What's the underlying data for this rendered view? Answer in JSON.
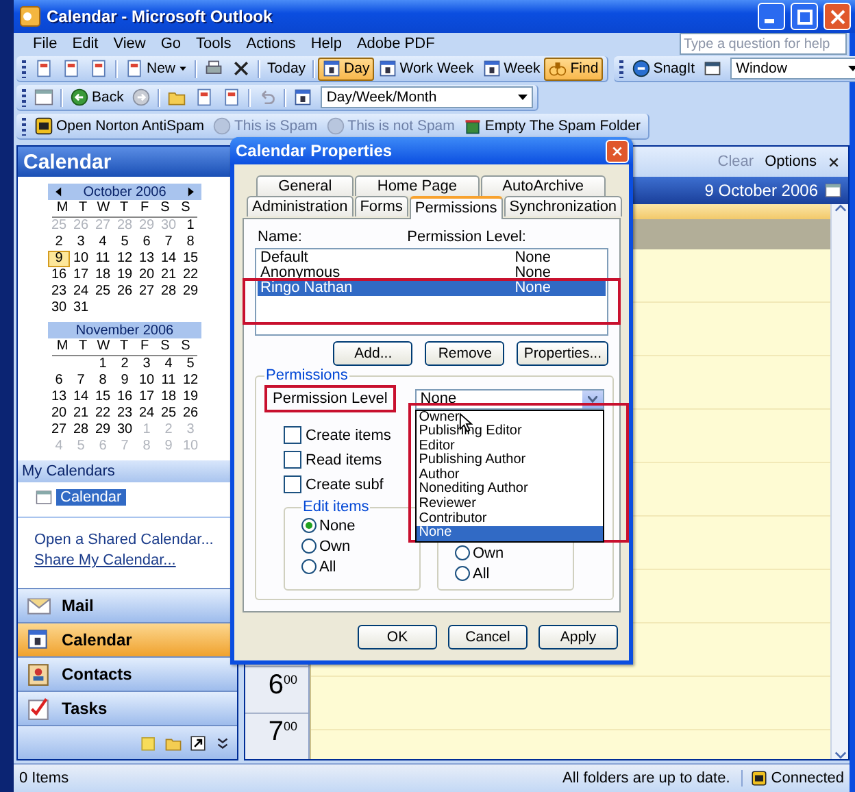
{
  "window": {
    "title": "Calendar - Microsoft Outlook"
  },
  "menu_bar": {
    "items": [
      "File",
      "Edit",
      "View",
      "Go",
      "Tools",
      "Actions",
      "Help",
      "Adobe PDF"
    ],
    "help_box": {
      "placeholder": "Type a question for help"
    }
  },
  "toolbar_rows": [
    [
      {
        "items": [
          {
            "kind": "icon"
          },
          {
            "kind": "icon"
          },
          {
            "kind": "icon"
          },
          {
            "kind": "separator"
          },
          {
            "kind": "menu_button",
            "label": "New",
            "selected": false,
            "disabled": false
          },
          {
            "kind": "separator"
          },
          {
            "kind": "icon"
          },
          {
            "kind": "icon"
          },
          {
            "kind": "separator"
          },
          {
            "kind": "button",
            "label": "Today",
            "selected": false,
            "disabled": false
          },
          {
            "kind": "separator"
          },
          {
            "kind": "icon_button",
            "label": "Day",
            "selected": true,
            "disabled": false
          },
          {
            "kind": "icon_button",
            "label": "Work Week",
            "selected": false,
            "disabled": false
          },
          {
            "kind": "icon_button",
            "label": "Week",
            "selected": false,
            "disabled": false
          },
          {
            "kind": "icon_button",
            "label": "Find",
            "selected": true,
            "disabled": false
          }
        ]
      },
      {
        "items": [
          {
            "kind": "icon_button",
            "label": "SnagIt",
            "selected": false,
            "disabled": false
          },
          {
            "kind": "icon"
          },
          {
            "kind": "dropdown",
            "value": "Window"
          }
        ]
      }
    ],
    [
      {
        "items": [
          {
            "kind": "icon"
          },
          {
            "kind": "separator"
          },
          {
            "kind": "icon_button",
            "label": "Back",
            "selected": false,
            "disabled": false
          },
          {
            "kind": "icon"
          },
          {
            "kind": "separator"
          },
          {
            "kind": "icon"
          },
          {
            "kind": "icon"
          },
          {
            "kind": "icon"
          },
          {
            "kind": "separator"
          },
          {
            "kind": "icon"
          },
          {
            "kind": "separator"
          },
          {
            "kind": "icon"
          },
          {
            "kind": "dropdown",
            "value": "Day/Week/Month"
          }
        ]
      }
    ],
    [
      {
        "items": [
          {
            "kind": "icon_button",
            "label": "Open Norton AntiSpam",
            "selected": false,
            "disabled": false
          },
          {
            "kind": "icon_button",
            "label": "This is Spam",
            "selected": false,
            "disabled": true
          },
          {
            "kind": "icon_button",
            "label": "This is not Spam",
            "selected": false,
            "disabled": true
          },
          {
            "kind": "icon_button",
            "label": "Empty The Spam Folder",
            "selected": false,
            "disabled": false
          }
        ]
      }
    ]
  ],
  "navigation_pane": {
    "title": "Calendar",
    "months": [
      {
        "title": "October 2006",
        "arrows": true,
        "weekdays": [
          "M",
          "T",
          "W",
          "T",
          "F",
          "S",
          "S"
        ],
        "weeks": [
          [
            {
              "kind": "day",
              "day": "25",
              "muted": true,
              "selected": false
            },
            {
              "kind": "day",
              "day": "26",
              "muted": true,
              "selected": false
            },
            {
              "kind": "day",
              "day": "27",
              "muted": true,
              "selected": false
            },
            {
              "kind": "day",
              "day": "28",
              "muted": true,
              "selected": false
            },
            {
              "kind": "day",
              "day": "29",
              "muted": true,
              "selected": false
            },
            {
              "kind": "day",
              "day": "30",
              "muted": true,
              "selected": false
            },
            {
              "kind": "day",
              "day": "1",
              "muted": false,
              "selected": false
            }
          ],
          [
            {
              "kind": "day",
              "day": "2",
              "muted": false,
              "selected": false
            },
            {
              "kind": "day",
              "day": "3",
              "muted": false,
              "selected": false
            },
            {
              "kind": "day",
              "day": "4",
              "muted": false,
              "selected": false
            },
            {
              "kind": "day",
              "day": "5",
              "muted": false,
              "selected": false
            },
            {
              "kind": "day",
              "day": "6",
              "muted": false,
              "selected": false
            },
            {
              "kind": "day",
              "day": "7",
              "muted": false,
              "selected": false
            },
            {
              "kind": "day",
              "day": "8",
              "muted": false,
              "selected": false
            }
          ],
          [
            {
              "kind": "day",
              "day": "9",
              "muted": false,
              "selected": true
            },
            {
              "kind": "day",
              "day": "10",
              "muted": false,
              "selected": false
            },
            {
              "kind": "day",
              "day": "11",
              "muted": false,
              "selected": false
            },
            {
              "kind": "day",
              "day": "12",
              "muted": false,
              "selected": false
            },
            {
              "kind": "day",
              "day": "13",
              "muted": false,
              "selected": false
            },
            {
              "kind": "day",
              "day": "14",
              "muted": false,
              "selected": false
            },
            {
              "kind": "day",
              "day": "15",
              "muted": false,
              "selected": false
            }
          ],
          [
            {
              "kind": "day",
              "day": "16",
              "muted": false,
              "selected": false
            },
            {
              "kind": "day",
              "day": "17",
              "muted": false,
              "selected": false
            },
            {
              "kind": "day",
              "day": "18",
              "muted": false,
              "selected": false
            },
            {
              "kind": "day",
              "day": "19",
              "muted": false,
              "selected": false
            },
            {
              "kind": "day",
              "day": "20",
              "muted": false,
              "selected": false
            },
            {
              "kind": "day",
              "day": "21",
              "muted": false,
              "selected": false
            },
            {
              "kind": "day",
              "day": "22",
              "muted": false,
              "selected": false
            }
          ],
          [
            {
              "kind": "day",
              "day": "23",
              "muted": false,
              "selected": false
            },
            {
              "kind": "day",
              "day": "24",
              "muted": false,
              "selected": false
            },
            {
              "kind": "day",
              "day": "25",
              "muted": false,
              "selected": false
            },
            {
              "kind": "day",
              "day": "26",
              "muted": false,
              "selected": false
            },
            {
              "kind": "day",
              "day": "27",
              "muted": false,
              "selected": false
            },
            {
              "kind": "day",
              "day": "28",
              "muted": false,
              "selected": false
            },
            {
              "kind": "day",
              "day": "29",
              "muted": false,
              "selected": false
            }
          ],
          [
            {
              "kind": "day",
              "day": "30",
              "muted": false,
              "selected": false
            },
            {
              "kind": "day",
              "day": "31",
              "muted": false,
              "selected": false
            },
            {
              "kind": "blank"
            },
            {
              "kind": "blank"
            },
            {
              "kind": "blank"
            },
            {
              "kind": "blank"
            },
            {
              "kind": "blank"
            }
          ]
        ]
      },
      {
        "title": "November 2006",
        "arrows": false,
        "weekdays": [
          "M",
          "T",
          "W",
          "T",
          "F",
          "S",
          "S"
        ],
        "weeks": [
          [
            {
              "kind": "blank"
            },
            {
              "kind": "blank"
            },
            {
              "kind": "day",
              "day": "1",
              "muted": false,
              "selected": false
            },
            {
              "kind": "day",
              "day": "2",
              "muted": false,
              "selected": false
            },
            {
              "kind": "day",
              "day": "3",
              "muted": false,
              "selected": false
            },
            {
              "kind": "day",
              "day": "4",
              "muted": false,
              "selected": false
            },
            {
              "kind": "day",
              "day": "5",
              "muted": false,
              "selected": false
            }
          ],
          [
            {
              "kind": "day",
              "day": "6",
              "muted": false,
              "selected": false
            },
            {
              "kind": "day",
              "day": "7",
              "muted": false,
              "selected": false
            },
            {
              "kind": "day",
              "day": "8",
              "muted": false,
              "selected": false
            },
            {
              "kind": "day",
              "day": "9",
              "muted": false,
              "selected": false
            },
            {
              "kind": "day",
              "day": "10",
              "muted": false,
              "selected": false
            },
            {
              "kind": "day",
              "day": "11",
              "muted": false,
              "selected": false
            },
            {
              "kind": "day",
              "day": "12",
              "muted": false,
              "selected": false
            }
          ],
          [
            {
              "kind": "day",
              "day": "13",
              "muted": false,
              "selected": false
            },
            {
              "kind": "day",
              "day": "14",
              "muted": false,
              "selected": false
            },
            {
              "kind": "day",
              "day": "15",
              "muted": false,
              "selected": false
            },
            {
              "kind": "day",
              "day": "16",
              "muted": false,
              "selected": false
            },
            {
              "kind": "day",
              "day": "17",
              "muted": false,
              "selected": false
            },
            {
              "kind": "day",
              "day": "18",
              "muted": false,
              "selected": false
            },
            {
              "kind": "day",
              "day": "19",
              "muted": false,
              "selected": false
            }
          ],
          [
            {
              "kind": "day",
              "day": "20",
              "muted": false,
              "selected": false
            },
            {
              "kind": "day",
              "day": "21",
              "muted": false,
              "selected": false
            },
            {
              "kind": "day",
              "day": "22",
              "muted": false,
              "selected": false
            },
            {
              "kind": "day",
              "day": "23",
              "muted": false,
              "selected": false
            },
            {
              "kind": "day",
              "day": "24",
              "muted": false,
              "selected": false
            },
            {
              "kind": "day",
              "day": "25",
              "muted": false,
              "selected": false
            },
            {
              "kind": "day",
              "day": "26",
              "muted": false,
              "selected": false
            }
          ],
          [
            {
              "kind": "day",
              "day": "27",
              "muted": false,
              "selected": false
            },
            {
              "kind": "day",
              "day": "28",
              "muted": false,
              "selected": false
            },
            {
              "kind": "day",
              "day": "29",
              "muted": false,
              "selected": false
            },
            {
              "kind": "day",
              "day": "30",
              "muted": false,
              "selected": false
            },
            {
              "kind": "day",
              "day": "1",
              "muted": true,
              "selected": false
            },
            {
              "kind": "day",
              "day": "2",
              "muted": true,
              "selected": false
            },
            {
              "kind": "day",
              "day": "3",
              "muted": true,
              "selected": false
            }
          ],
          [
            {
              "kind": "day",
              "day": "4",
              "muted": true,
              "selected": false
            },
            {
              "kind": "day",
              "day": "5",
              "muted": true,
              "selected": false
            },
            {
              "kind": "day",
              "day": "6",
              "muted": true,
              "selected": false
            },
            {
              "kind": "day",
              "day": "7",
              "muted": true,
              "selected": false
            },
            {
              "kind": "day",
              "day": "8",
              "muted": true,
              "selected": false
            },
            {
              "kind": "day",
              "day": "9",
              "muted": true,
              "selected": false
            },
            {
              "kind": "day",
              "day": "10",
              "muted": true,
              "selected": false
            }
          ]
        ]
      }
    ],
    "my_calendars": {
      "title": "My Calendars",
      "items": [
        {
          "label": "Calendar",
          "selected": true
        }
      ]
    },
    "links": [
      {
        "label": "Open a Shared Calendar...",
        "hovered": false
      },
      {
        "label": "Share My Calendar...",
        "hovered": true
      }
    ],
    "buttons": [
      {
        "label": "Mail",
        "selected": false
      },
      {
        "label": "Calendar",
        "selected": true
      },
      {
        "label": "Contacts",
        "selected": false
      },
      {
        "label": "Tasks",
        "selected": false
      }
    ]
  },
  "calendar_view": {
    "toolbar": [
      {
        "label": "Clear",
        "disabled": true
      },
      {
        "label": "Options",
        "disabled": false
      }
    ],
    "date": "9 October 2006",
    "hours": [
      {
        "hour": "6",
        "minutes": "00"
      },
      {
        "hour": "7",
        "minutes": "00"
      }
    ]
  },
  "dialog": {
    "title": "Calendar Properties",
    "tab_rows": [
      [
        {
          "label": "General",
          "selected": false
        },
        {
          "label": "Home Page",
          "selected": false
        },
        {
          "label": "AutoArchive",
          "selected": false
        }
      ],
      [
        {
          "label": "Administration",
          "selected": false
        },
        {
          "label": "Forms",
          "selected": false
        },
        {
          "label": "Permissions",
          "selected": true
        },
        {
          "label": "Synchronization",
          "selected": false
        }
      ]
    ],
    "columns": [
      "Name:",
      "Permission Level:"
    ],
    "rows": [
      {
        "name": "Default",
        "permission": "None",
        "selected": false,
        "highlighted": false
      },
      {
        "name": "Anonymous",
        "permission": "None",
        "selected": false,
        "highlighted": false
      },
      {
        "name": "Ringo Nathan",
        "permission": "None",
        "selected": true,
        "highlighted": true
      }
    ],
    "list_buttons": [
      "Add...",
      "Remove",
      "Properties..."
    ],
    "group": {
      "title": "Permissions",
      "level_label": {
        "text": "Permission Level",
        "highlighted": true
      },
      "combo": {
        "value": "None",
        "expanded": true,
        "highlighted": true
      },
      "options": [
        {
          "label": "Owner",
          "selected": false
        },
        {
          "label": "Publishing Editor",
          "selected": false
        },
        {
          "label": "Editor",
          "selected": false
        },
        {
          "label": "Publishing Author",
          "selected": false
        },
        {
          "label": "Author",
          "selected": false
        },
        {
          "label": "Nonediting Author",
          "selected": false
        },
        {
          "label": "Reviewer",
          "selected": false
        },
        {
          "label": "Contributor",
          "selected": false
        },
        {
          "label": "None",
          "selected": true
        }
      ],
      "checkboxes": [
        {
          "label": "Create items",
          "checked": false
        },
        {
          "label": "Read items",
          "checked": false
        },
        {
          "label": "Create subf",
          "checked": false
        }
      ],
      "edit_items": {
        "title": "Edit items",
        "radios": [
          {
            "label": "None",
            "selected": true
          },
          {
            "label": "Own",
            "selected": false
          },
          {
            "label": "All",
            "selected": false
          }
        ]
      },
      "delete_items": {
        "radios": [
          {
            "label": "Own",
            "selected": false
          },
          {
            "label": "All",
            "selected": false
          }
        ]
      }
    },
    "buttons": [
      "OK",
      "Cancel",
      "Apply"
    ]
  },
  "status_bar": {
    "items": "0 Items",
    "sync": "All folders are up to date.",
    "connection": "Connected"
  }
}
